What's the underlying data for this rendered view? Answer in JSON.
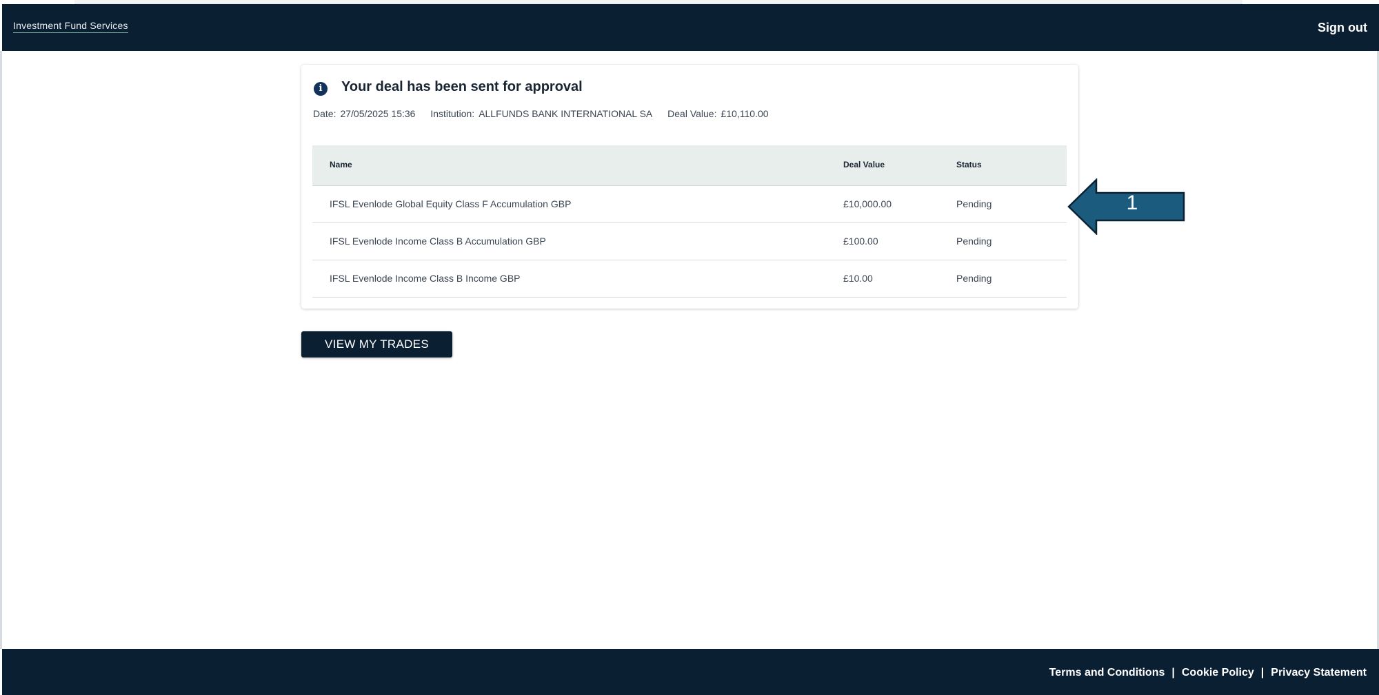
{
  "header": {
    "brand": "Investment Fund Services",
    "sign_out": "Sign out"
  },
  "confirmation": {
    "icon": "info-icon",
    "title": "Your deal has been sent for approval",
    "meta": {
      "date_label": "Date:",
      "date_value": "27/05/2025 15:36",
      "institution_label": "Institution:",
      "institution_value": "ALLFUNDS BANK INTERNATIONAL SA",
      "deal_value_label": "Deal Value:",
      "deal_value_value": "£10,110.00"
    },
    "table": {
      "columns": [
        "Name",
        "Deal Value",
        "Status"
      ],
      "rows": [
        {
          "name": "IFSL Evenlode Global Equity Class F Accumulation GBP",
          "deal_value": "£10,000.00",
          "status": "Pending"
        },
        {
          "name": "IFSL Evenlode Income Class B Accumulation GBP",
          "deal_value": "£100.00",
          "status": "Pending"
        },
        {
          "name": "IFSL Evenlode Income Class B Income GBP",
          "deal_value": "£10.00",
          "status": "Pending"
        }
      ]
    }
  },
  "actions": {
    "view_trades": "VIEW MY TRADES"
  },
  "callout": {
    "number": "1",
    "color": "#1b5b7e"
  },
  "footer": {
    "terms": "Terms and Conditions",
    "cookie": "Cookie Policy",
    "privacy": "Privacy Statement",
    "separator": "|"
  }
}
